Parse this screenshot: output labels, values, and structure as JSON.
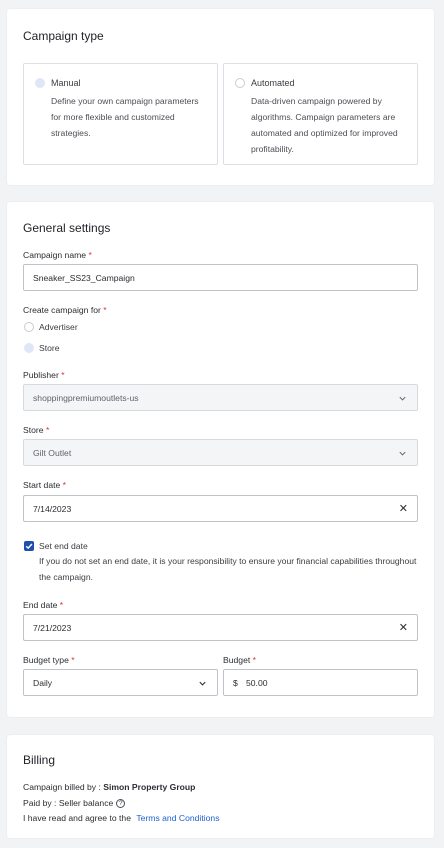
{
  "campaign_type": {
    "title": "Campaign type",
    "manual": {
      "title": "Manual",
      "description": "Define your own campaign parameters for more flexible and customized strategies."
    },
    "automated": {
      "title": "Automated",
      "description": "Data-driven campaign powered by algorithms. Campaign parameters are automated and optimized for improved profitability."
    },
    "selected": "manual"
  },
  "general": {
    "title": "General settings",
    "campaign_name": {
      "label": "Campaign name",
      "value": "Sneaker_SS23_Campaign"
    },
    "create_for": {
      "label": "Create campaign for",
      "options": [
        "Advertiser",
        "Store"
      ],
      "selected": "Store"
    },
    "publisher": {
      "label": "Publisher",
      "value": "shoppingpremiumoutlets-us"
    },
    "store": {
      "label": "Store",
      "value": "Gilt Outlet"
    },
    "start_date": {
      "label": "Start date",
      "value": "7/14/2023"
    },
    "set_end_date": {
      "label": "Set end date",
      "checked": true,
      "helper": "If you do not set an end date, it is your responsibility to ensure your financial capabilities throughout the campaign."
    },
    "end_date": {
      "label": "End date",
      "value": "7/21/2023"
    },
    "budget_type": {
      "label": "Budget type",
      "value": "Daily"
    },
    "budget": {
      "label": "Budget",
      "currency": "$",
      "value": "50.00"
    },
    "required_mark": "*"
  },
  "billing": {
    "title": "Billing",
    "billed_by_label": "Campaign billed by :",
    "billed_by_value": "Simon Property Group",
    "paid_by": "Paid by : Seller balance",
    "help_icon": "?",
    "agree_text": "I have read and agree to the",
    "terms_link": "Terms and Conditions"
  },
  "colors": {
    "accent": "#1c4fb0",
    "link": "#1f5fd1",
    "required": "#d6322e"
  }
}
